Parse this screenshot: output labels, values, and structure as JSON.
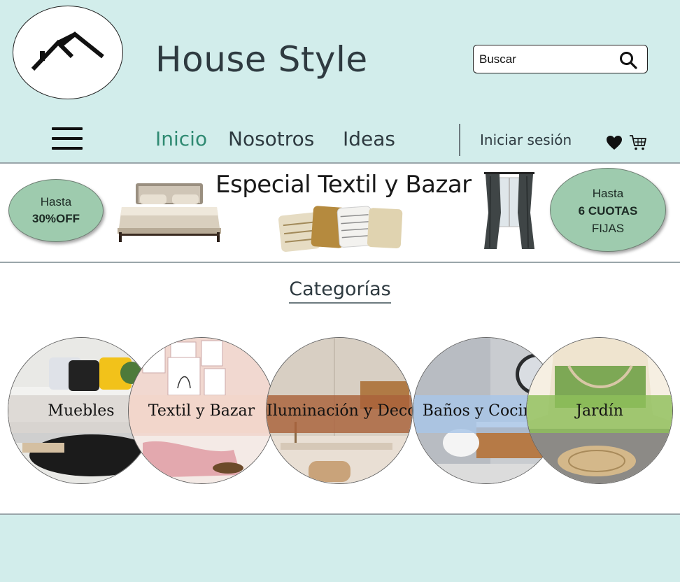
{
  "header": {
    "title": "House Style",
    "search": {
      "placeholder": "Buscar",
      "value": ""
    },
    "nav": {
      "links": [
        "Inicio",
        "Nosotros",
        "Ideas"
      ],
      "active": "Inicio",
      "login_label": "Iniciar sesión"
    },
    "icons": [
      "house-logo-icon",
      "search-icon",
      "menu-icon",
      "heart-icon",
      "cart-icon"
    ]
  },
  "banner": {
    "title": "Especial Textil y Bazar",
    "left_badge": {
      "line1": "Hasta",
      "line2": "30%OFF"
    },
    "right_badge": {
      "line1": "Hasta",
      "line2": "6 CUOTAS",
      "line3": "FIJAS"
    }
  },
  "categories": {
    "title": "Categorías",
    "items": [
      {
        "label": "Muebles",
        "band_color": "#d9d4cf"
      },
      {
        "label": "Textil y Bazar",
        "band_color": "#f2d6c9"
      },
      {
        "label": "Iluminación y Deco",
        "band_color": "#a9623a"
      },
      {
        "label": "Baños y Cocinas",
        "band_color": "#a8c6e8"
      },
      {
        "label": "Jardín",
        "band_color": "#8fbf5a"
      }
    ]
  },
  "colors": {
    "header_bg": "#d2edeb",
    "active_nav": "#2f8a72",
    "badge_fill": "#9ecbae",
    "text_dark": "#2e3a40"
  }
}
